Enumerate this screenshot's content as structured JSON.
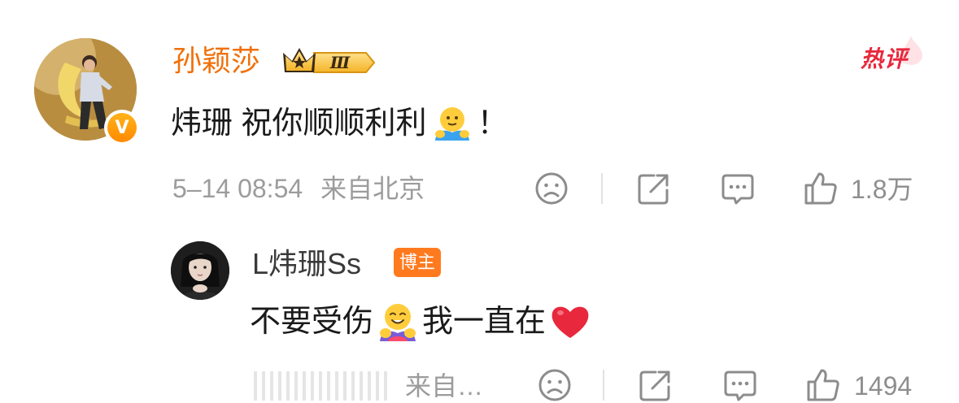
{
  "main_comment": {
    "username": "孙颖莎",
    "vip_level": "Ⅲ",
    "verified_mark": "V",
    "hot_tag": "热评",
    "text_before": "炜珊 祝你顺顺利利",
    "emoji": "hug-emoji",
    "text_after": "！",
    "timestamp": "5–14 08:54",
    "location": "来自北京",
    "like_count": "1.8万"
  },
  "reply": {
    "username": "L炜珊Ss",
    "badge": "博主",
    "text_part1": "不要受伤",
    "emoji1": "hugging-face-emoji",
    "text_part2": "我一直在",
    "emoji2": "red-heart-emoji",
    "location": "来自…",
    "like_count": "1494"
  },
  "colors": {
    "username_orange": "#f0700a",
    "hot_red": "#e8283c",
    "host_badge": "#ff7a1f",
    "meta_gray": "#9c9c9c"
  },
  "icons": [
    "sad-face-icon",
    "share-icon",
    "comment-icon",
    "thumbs-up-icon"
  ]
}
